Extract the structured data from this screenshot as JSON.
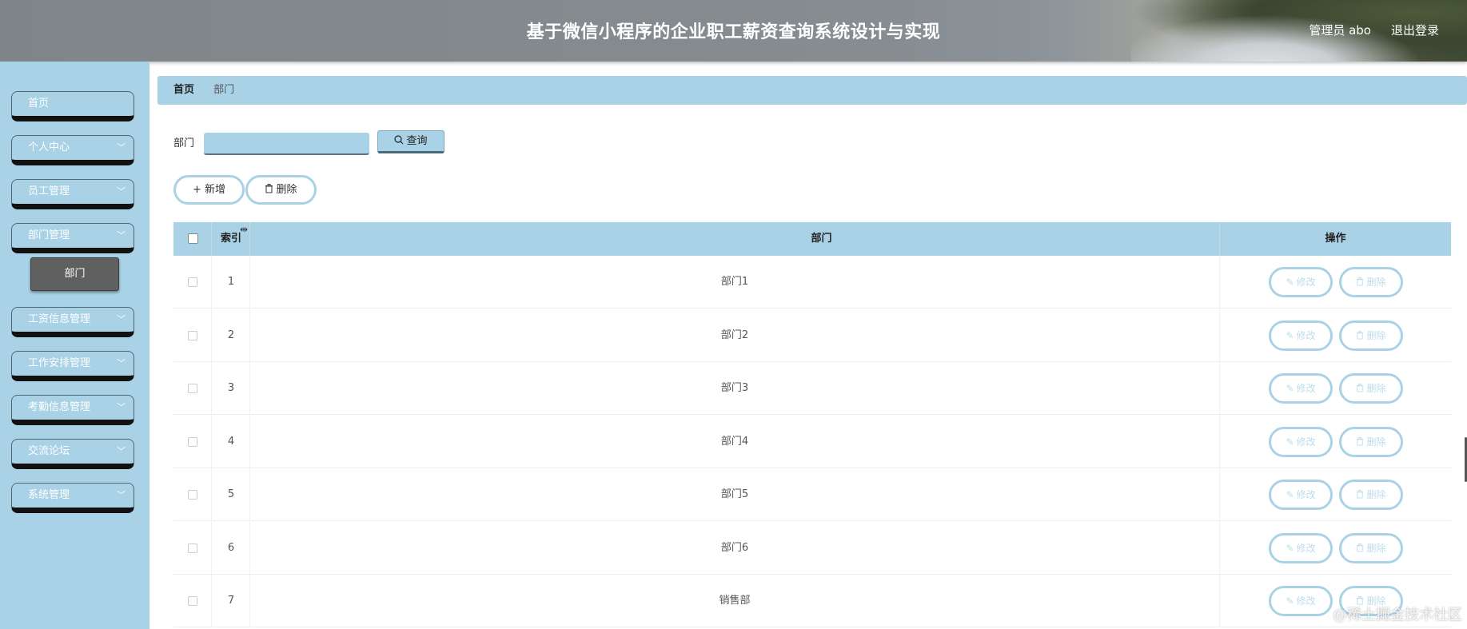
{
  "header": {
    "title": "基于微信小程序的企业职工薪资查询系统设计与实现",
    "user": "管理员 abo",
    "logout": "退出登录"
  },
  "sidebar": {
    "items": [
      {
        "label": "首页",
        "has_chevron": false
      },
      {
        "label": "个人中心",
        "has_chevron": true
      },
      {
        "label": "员工管理",
        "has_chevron": true
      },
      {
        "label": "部门管理",
        "has_chevron": true
      },
      {
        "label": "工资信息管理",
        "has_chevron": true
      },
      {
        "label": "工作安排管理",
        "has_chevron": true
      },
      {
        "label": "考勤信息管理",
        "has_chevron": true
      },
      {
        "label": "交流论坛",
        "has_chevron": true
      },
      {
        "label": "系统管理",
        "has_chevron": true
      }
    ],
    "submenu_active": "部门"
  },
  "breadcrumb": {
    "home": "首页",
    "current": "部门"
  },
  "search": {
    "label": "部门",
    "value": "",
    "button_label": "查询"
  },
  "actions": {
    "add_label": "新增",
    "delete_label": "删除"
  },
  "table": {
    "columns": [
      "索引",
      "部门",
      "操作"
    ],
    "rows": [
      {
        "index": "1",
        "dept": "部门1"
      },
      {
        "index": "2",
        "dept": "部门2"
      },
      {
        "index": "3",
        "dept": "部门3"
      },
      {
        "index": "4",
        "dept": "部门4"
      },
      {
        "index": "5",
        "dept": "部门5"
      },
      {
        "index": "6",
        "dept": "部门6"
      },
      {
        "index": "7",
        "dept": "销售部"
      }
    ],
    "row_actions": {
      "edit_label": "修改",
      "delete_label": "删除"
    }
  },
  "watermark": "@稀土掘金技术社区",
  "colors": {
    "accent": "#a9d2e6",
    "header_bg": "#868c90",
    "submenu_active_bg": "#606060"
  },
  "icons": {
    "search": "search-icon",
    "add": "plus-icon",
    "delete": "trash-icon",
    "edit": "pencil-icon",
    "chevron": "chevron-down-icon"
  }
}
